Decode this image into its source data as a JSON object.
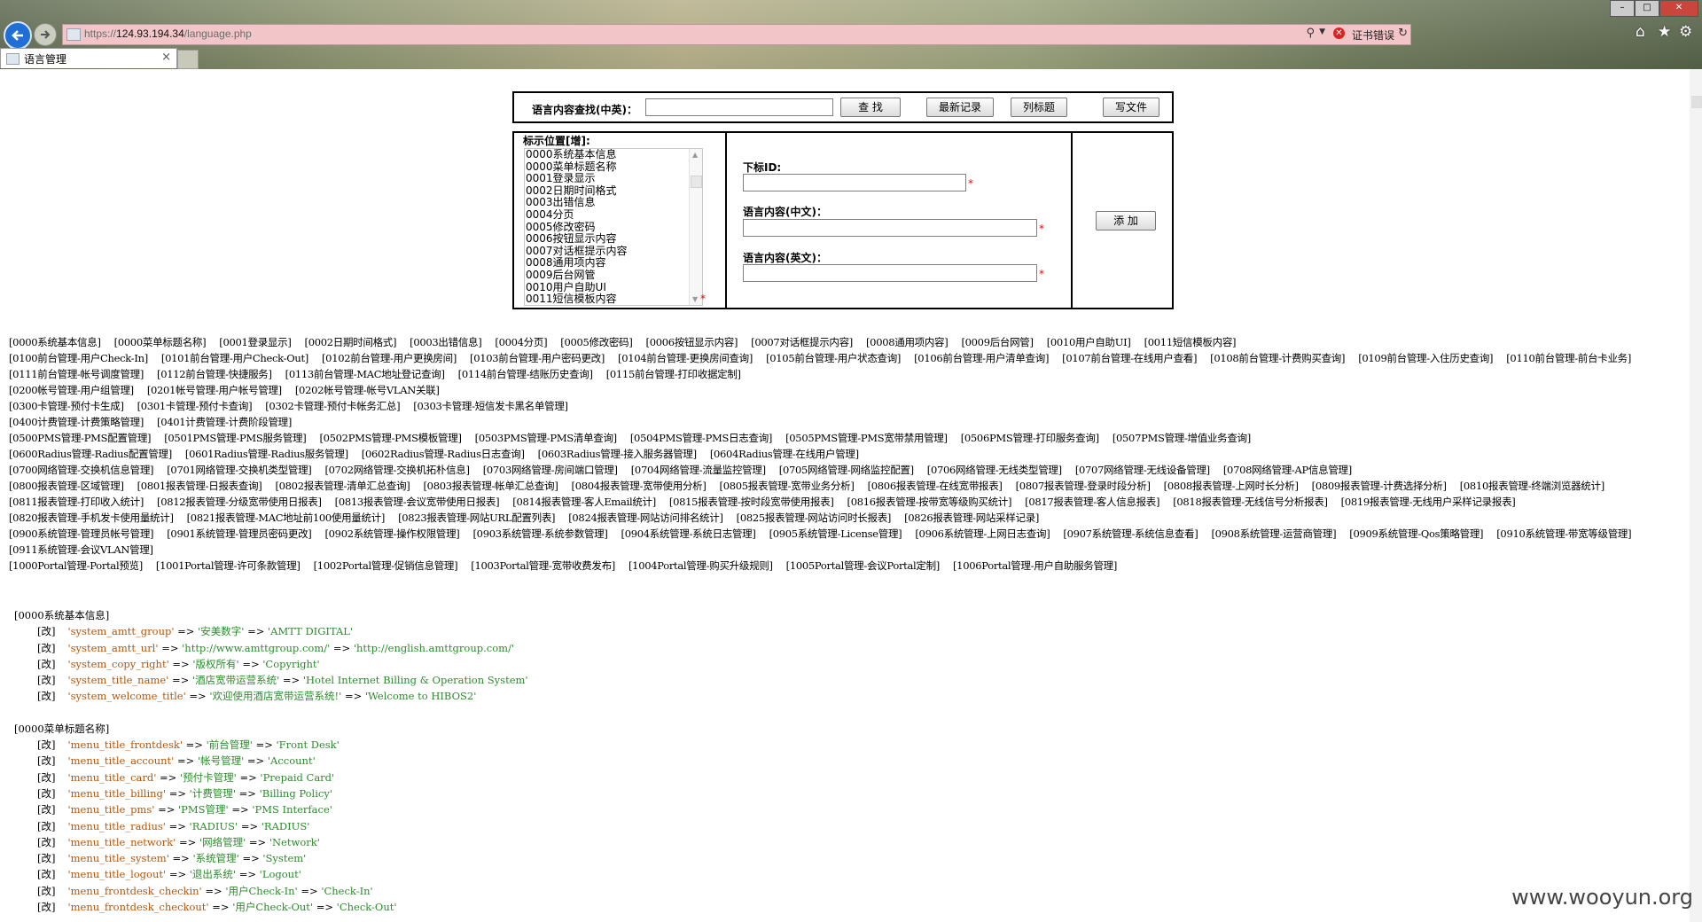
{
  "browser": {
    "url_prefix": "https://",
    "url_host": "124.93.194.34",
    "url_path": "/language.php",
    "cert_label": "证书错误",
    "tab_title": "语言管理",
    "tab_close": "×"
  },
  "search": {
    "label": "语言内容查找(中英)：",
    "find_btn": "查 找",
    "latest_btn": "最新记录",
    "list_btn": "列标题",
    "write_btn": "写文件"
  },
  "form": {
    "pos_label": "标示位置[增]:",
    "options": [
      "0000系统基本信息",
      "0000菜单标题名称",
      "0001登录显示",
      "0002日期时间格式",
      "0003出错信息",
      "0004分页",
      "0005修改密码",
      "0006按钮显示内容",
      "0007对话框提示内容",
      "0008通用项内容",
      "0009后台网管",
      "0010用户自助UI",
      "0011短信模板内容"
    ],
    "id_label": "下标ID:",
    "cn_label": "语言内容(中文)：",
    "en_label": "语言内容(英文)：",
    "add_btn": "添 加",
    "required_mark": "*"
  },
  "links": [
    "[0000系统基本信息]",
    "[0000菜单标题名称]",
    "[0001登录显示]",
    "[0002日期时间格式]",
    "[0003出错信息]",
    "[0004分页]",
    "[0005修改密码]",
    "[0006按钮显示内容]",
    "[0007对话框提示内容]",
    "[0008通用项内容]",
    "[0009后台网管]",
    "[0010用户自助UI]",
    "[0011短信模板内容]",
    "[0100前台管理-用户Check-In]",
    "[0101前台管理-用户Check-Out]",
    "[0102前台管理-用户更换房间]",
    "[0103前台管理-用户密码更改]",
    "[0104前台管理-更换房间查询]",
    "[0105前台管理-用户状态查询]",
    "[0106前台管理-用户清单查询]",
    "[0107前台管理-在线用户查看]",
    "[0108前台管理-计费购买查询]",
    "[0109前台管理-入住历史查询]",
    "[0110前台管理-前台卡业务]",
    "[0111前台管理-帐号调度管理]",
    "[0112前台管理-快捷服务]",
    "[0113前台管理-MAC地址登记查询]",
    "[0114前台管理-结账历史查询]",
    "[0115前台管理-打印收据定制]",
    "[0200帐号管理-用户组管理]",
    "[0201帐号管理-用户帐号管理]",
    "[0202帐号管理-帐号VLAN关联]",
    "[0300卡管理-预付卡生成]",
    "[0301卡管理-预付卡查询]",
    "[0302卡管理-预付卡帐务汇总]",
    "[0303卡管理-短信发卡黑名单管理]",
    "[0400计费管理-计费策略管理]",
    "[0401计费管理-计费阶段管理]",
    "[0500PMS管理-PMS配置管理]",
    "[0501PMS管理-PMS服务管理]",
    "[0502PMS管理-PMS模板管理]",
    "[0503PMS管理-PMS清单查询]",
    "[0504PMS管理-PMS日志查询]",
    "[0505PMS管理-PMS宽带禁用管理]",
    "[0506PMS管理-打印服务查询]",
    "[0507PMS管理-增值业务查询]",
    "[0600Radius管理-Radius配置管理]",
    "[0601Radius管理-Radius服务管理]",
    "[0602Radius管理-Radius日志查询]",
    "[0603Radius管理-接入服务器管理]",
    "[0604Radius管理-在线用户管理]",
    "[0700网络管理-交换机信息管理]",
    "[0701网络管理-交换机类型管理]",
    "[0702网络管理-交换机拓朴信息]",
    "[0703网络管理-房间端口管理]",
    "[0704网络管理-流量监控管理]",
    "[0705网络管理-网络监控配置]",
    "[0706网络管理-无线类型管理]",
    "[0707网络管理-无线设备管理]",
    "[0708网络管理-AP信息管理]",
    "[0800报表管理-区域管理]",
    "[0801报表管理-日报表查询]",
    "[0802报表管理-清单汇总查询]",
    "[0803报表管理-帐单汇总查询]",
    "[0804报表管理-宽带使用分析]",
    "[0805报表管理-宽带业务分析]",
    "[0806报表管理-在线宽带报表]",
    "[0807报表管理-登录时段分析]",
    "[0808报表管理-上网时长分析]",
    "[0809报表管理-计费选择分析]",
    "[0810报表管理-终端浏览器统计]",
    "[0811报表管理-打印收入统计]",
    "[0812报表管理-分级宽带使用日报表]",
    "[0813报表管理-会议宽带使用日报表]",
    "[0814报表管理-客人Email统计]",
    "[0815报表管理-按时段宽带使用报表]",
    "[0816报表管理-按带宽等级购买统计]",
    "[0817报表管理-客人信息报表]",
    "[0818报表管理-无线信号分析报表]",
    "[0819报表管理-无线用户采样记录报表]",
    "[0820报表管理-手机发卡使用量统计]",
    "[0821报表管理-MAC地址前100使用量统计]",
    "[0823报表管理-网站URL配置列表]",
    "[0824报表管理-网站访问排名统计]",
    "[0825报表管理-网站访问时长报表]",
    "[0826报表管理-网站采样记录]",
    "[0900系统管理-管理员帐号管理]",
    "[0901系统管理-管理员密码更改]",
    "[0902系统管理-操作权限管理]",
    "[0903系统管理-系统参数管理]",
    "[0904系统管理-系统日志管理]",
    "[0905系统管理-License管理]",
    "[0906系统管理-上网日志查询]",
    "[0907系统管理-系统信息查看]",
    "[0908系统管理-运营商管理]",
    "[0909系统管理-Qos策略管理]",
    "[0910系统管理-带宽等级管理]",
    "[0911系统管理-会议VLAN管理]",
    "[1000Portal管理-Portal预览]",
    "[1001Portal管理-许可条款管理]",
    "[1002Portal管理-促销信息管理]",
    "[1003Portal管理-宽带收费发布]",
    "[1004Portal管理-购买升级规则]",
    "[1005Portal管理-会议Portal定制]",
    "[1006Portal管理-用户自助服务管理]"
  ],
  "link_line_breaks_after": [
    12,
    28,
    31,
    35,
    37,
    45,
    50,
    59,
    85,
    97
  ],
  "sections": [
    {
      "title": "[0000系统基本信息]",
      "rows": [
        {
          "edit": "[改]",
          "key": "'system_amtt_group'",
          "cn": "'安美数字'",
          "en": "'AMTT DIGITAL'"
        },
        {
          "edit": "[改]",
          "key": "'system_amtt_url'",
          "cn": "'http://www.amttgroup.com/'",
          "en": "'http://english.amttgroup.com/'"
        },
        {
          "edit": "[改]",
          "key": "'system_copy_right'",
          "cn": "'版权所有'",
          "en": "'Copyright'"
        },
        {
          "edit": "[改]",
          "key": "'system_title_name'",
          "cn": "'酒店宽带运营系统'",
          "en": "'Hotel Internet Billing & Operation System'"
        },
        {
          "edit": "[改]",
          "key": "'system_welcome_title'",
          "cn": "'欢迎使用酒店宽带运营系统!'",
          "en": "'Welcome to HIBOS2'"
        }
      ]
    },
    {
      "title": "[0000菜单标题名称]",
      "rows": [
        {
          "edit": "[改]",
          "key": "'menu_title_frontdesk'",
          "cn": "'前台管理'",
          "en": "'Front Desk'"
        },
        {
          "edit": "[改]",
          "key": "'menu_title_account'",
          "cn": "'帐号管理'",
          "en": "'Account'"
        },
        {
          "edit": "[改]",
          "key": "'menu_title_card'",
          "cn": "'预付卡管理'",
          "en": "'Prepaid Card'"
        },
        {
          "edit": "[改]",
          "key": "'menu_title_billing'",
          "cn": "'计费管理'",
          "en": "'Billing Policy'"
        },
        {
          "edit": "[改]",
          "key": "'menu_title_pms'",
          "cn": "'PMS管理'",
          "en": "'PMS Interface'"
        },
        {
          "edit": "[改]",
          "key": "'menu_title_radius'",
          "cn": "'RADIUS'",
          "en": "'RADIUS'"
        },
        {
          "edit": "[改]",
          "key": "'menu_title_network'",
          "cn": "'网络管理'",
          "en": "'Network'"
        },
        {
          "edit": "[改]",
          "key": "'menu_title_system'",
          "cn": "'系统管理'",
          "en": "'System'"
        },
        {
          "edit": "[改]",
          "key": "'menu_title_logout'",
          "cn": "'退出系统'",
          "en": "'Logout'"
        },
        {
          "edit": "[改]",
          "key": "'menu_frontdesk_checkin'",
          "cn": "'用户Check-In'",
          "en": "'Check-In'"
        },
        {
          "edit": "[改]",
          "key": "'menu_frontdesk_checkout'",
          "cn": "'用户Check-Out'",
          "en": "'Check-Out'"
        }
      ]
    }
  ],
  "arrow": "=>",
  "watermark": "www.wooyun.org"
}
